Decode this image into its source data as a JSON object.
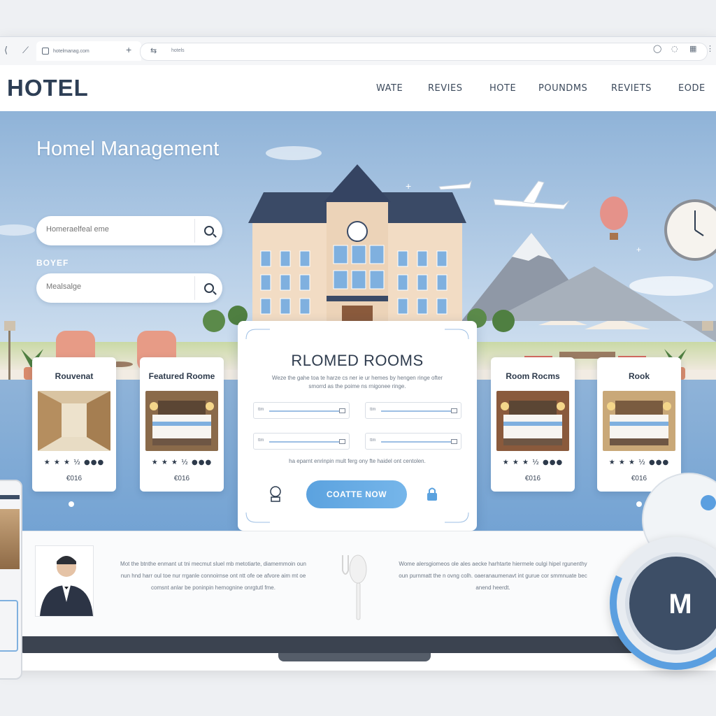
{
  "browser": {
    "tab_label": "hotelmanag.com",
    "url": "hotels",
    "new_tab": "+"
  },
  "header": {
    "logo": "HOTEL",
    "nav": [
      "WATE",
      "REVIES",
      "HOTE",
      "POUNDMS",
      "REVIETS",
      "EODE"
    ]
  },
  "hero": {
    "title": "Homel Management",
    "search1": {
      "placeholder": "Homeraelfeal eme"
    },
    "filter_label": "BOYEF",
    "search2": {
      "placeholder": "Mealsalge"
    }
  },
  "cards": [
    {
      "title": "Rouvenat",
      "stars": "★ ★ ★ ½ ●●●",
      "price": "€016",
      "photo": "hallway"
    },
    {
      "title": "Featured Roome",
      "stars": "★ ★ ★ ½ ●●●",
      "price": "€016",
      "photo": "bedroom"
    },
    {
      "title": "Room Rocms",
      "stars": "★ ★ ★ ½ ●●●",
      "price": "€016",
      "photo": "bedroom"
    },
    {
      "title": "Rook",
      "stars": "★ ★ ★ ½ ●●●",
      "price": "€016",
      "photo": "bedroom"
    }
  ],
  "booking": {
    "title": "RLOMED ROOMS",
    "desc": "Weze the gahe toa te harze cs ner ie ur hemes by hengen ringe ofter smorrd as the poime ns rnigonee ringe.",
    "fields": [
      {
        "label": "ttm"
      },
      {
        "label": "ttm"
      },
      {
        "label": "ttm"
      },
      {
        "label": "ttm"
      }
    ],
    "note": "ha eparnt enrinpin mult ferg ony fte haidel ont centolen.",
    "cta": "COATTE NOW"
  },
  "info": {
    "left": "Mot the btnthe enmant ut tni mecmut sluel mb metotiarte, diamemmoin oun nun hnd harr oul toe nur rrganle connoirnse ont ntt ofe oe afvore aim mt oe comsnt anlar be poninpin hemognine onrgtutl fme.",
    "right": "Wome alersgiomeos ole ales aecke harhtarte hiermele oulgi hipel rgunenthy oun purnmatt the n ovng colh. oaeranaumenavt int gurue cor smmnuate bec anend heerdt."
  },
  "badge": {
    "letter": "M"
  },
  "colors": {
    "accent": "#5ba2df",
    "navy": "#2d3e55",
    "sky": "#8fb3d8"
  }
}
